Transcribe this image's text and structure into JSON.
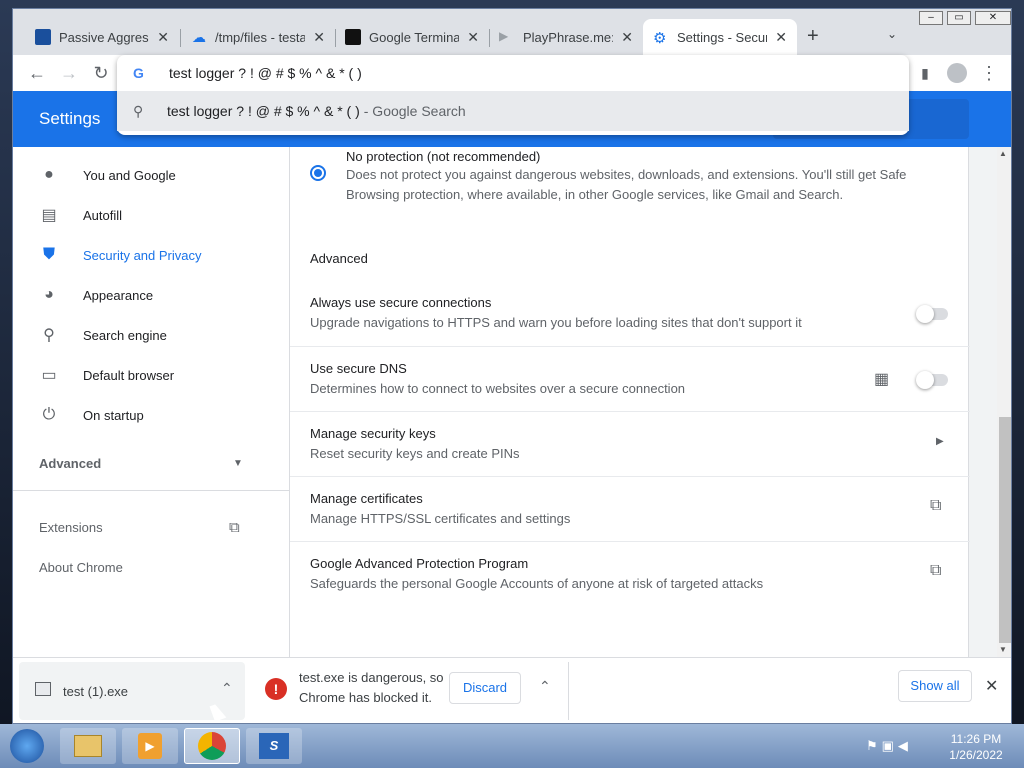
{
  "tabs": [
    {
      "title": "Passive Aggressiv",
      "icon": "square-icon",
      "color": "#1a4f9c"
    },
    {
      "title": "/tmp/files - testa",
      "icon": "cloud-upload-icon",
      "color": "#1a73e8"
    },
    {
      "title": "Google Terminal",
      "icon": "terminal-icon",
      "color": "#111111"
    },
    {
      "title": "PlayPhrase.me: S",
      "icon": "play-icon",
      "color": "#9aa0a6"
    },
    {
      "title": "Settings - Securit",
      "icon": "gear-icon",
      "color": "#1a73e8",
      "active": true
    }
  ],
  "new_tab_glyph": "+",
  "tab_close_glyph": "✕",
  "omnibox": {
    "query": "test logger ? ! @ # $ % ^ & * ( )",
    "suggestion": "test logger ? ! @ # $ % ^ & * ( )",
    "suggestion_suffix": "- Google Search"
  },
  "header": {
    "title": "Settings"
  },
  "sidebar": {
    "items": [
      {
        "label": "You and Google",
        "icon": "person-icon"
      },
      {
        "label": "Autofill",
        "icon": "clipboard-icon"
      },
      {
        "label": "Security and Privacy",
        "icon": "shield-icon",
        "selected": true
      },
      {
        "label": "Appearance",
        "icon": "palette-icon"
      },
      {
        "label": "Search engine",
        "icon": "search-icon"
      },
      {
        "label": "Default browser",
        "icon": "browser-icon"
      },
      {
        "label": "On startup",
        "icon": "power-icon"
      }
    ],
    "advanced": "Advanced",
    "extensions": "Extensions",
    "about": "About Chrome"
  },
  "content": {
    "no_protection_title": "No protection (not recommended)",
    "no_protection_desc_1": "Does not protect you against dangerous websites, downloads, and extensions. You'll still get Safe",
    "no_protection_desc_2": "Browsing protection, where available, in other Google services, like Gmail and Search.",
    "advanced_heading": "Advanced",
    "rows": [
      {
        "title": "Always use secure connections",
        "desc": "Upgrade navigations to HTTPS and warn you before loading sites that don't support it",
        "control": "toggle",
        "state": "off"
      },
      {
        "title": "Use secure DNS",
        "desc": "Determines how to connect to websites over a secure connection",
        "control": "toggle",
        "state": "off",
        "managed": true
      },
      {
        "title": "Manage security keys",
        "desc": "Reset security keys and create PINs",
        "control": "arrow"
      },
      {
        "title": "Manage certificates",
        "desc": "Manage HTTPS/SSL certificates and settings",
        "control": "external"
      },
      {
        "title": "Google Advanced Protection Program",
        "desc": "Safeguards the personal Google Accounts of anyone at risk of targeted attacks",
        "control": "external"
      }
    ]
  },
  "downloads": {
    "file": "test (1).exe",
    "warning_1": "test.exe is dangerous, so",
    "warning_2": "Chrome has blocked it.",
    "discard": "Discard",
    "show_all": "Show all"
  },
  "taskbar": {
    "time": "11:26 PM",
    "date": "1/26/2022"
  },
  "colors": {
    "accent": "#1a73e8",
    "danger": "#d93025"
  }
}
